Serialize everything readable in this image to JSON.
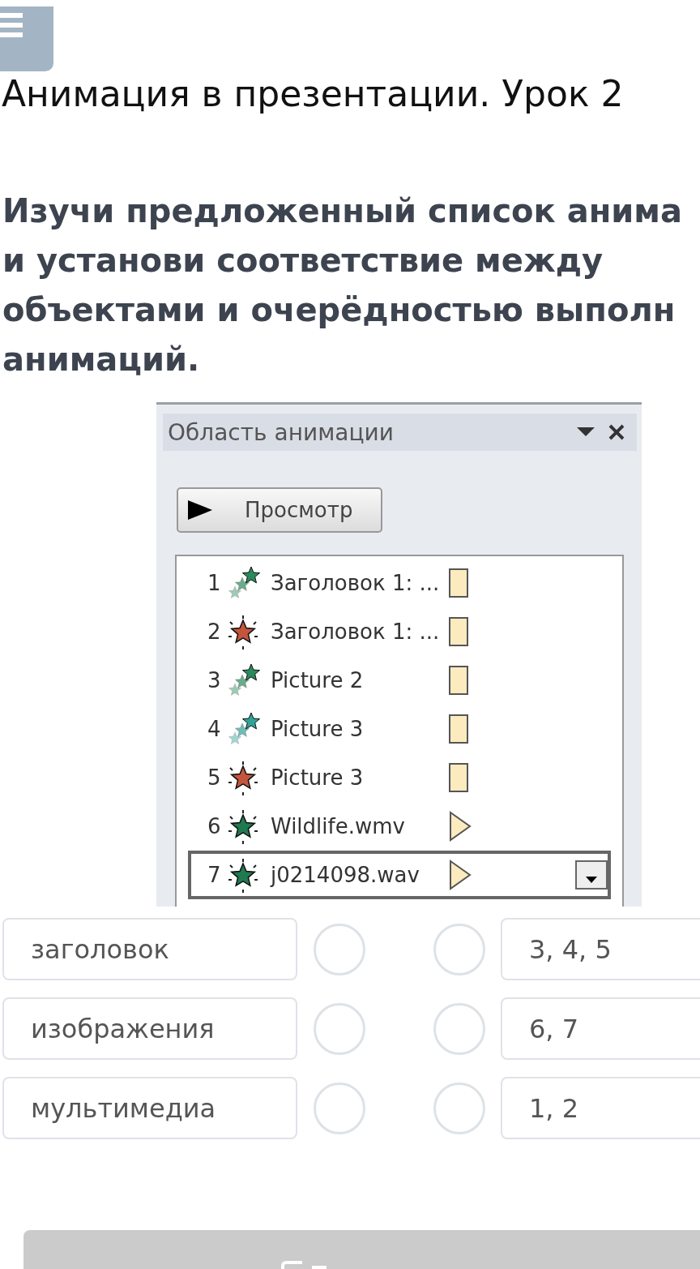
{
  "page_title": "Анимация в презентации. Урок 2",
  "instruction_lines": [
    "Изучи предложенный список анима",
    "и установи соответствие между",
    "объектами и очерёдностью выполн",
    "анимаций."
  ],
  "animation_pane": {
    "title": "Область анимации",
    "preview_button": "Просмотр",
    "items": [
      {
        "number": "1",
        "icon": {
          "kind": "path",
          "color": "#2a8a5c"
        },
        "name": "Заголовок 1: ...",
        "marker": {
          "kind": "bar"
        },
        "selected": false
      },
      {
        "number": "2",
        "icon": {
          "kind": "effect",
          "color": "#c4553d"
        },
        "name": "Заголовок 1: ...",
        "marker": {
          "kind": "bar"
        },
        "selected": false
      },
      {
        "number": "3",
        "icon": {
          "kind": "path",
          "color": "#2a8a5c"
        },
        "name": "Picture 2",
        "marker": {
          "kind": "bar"
        },
        "selected": false
      },
      {
        "number": "4",
        "icon": {
          "kind": "path",
          "color": "#2fa39a"
        },
        "name": "Picture 3",
        "marker": {
          "kind": "bar"
        },
        "selected": false
      },
      {
        "number": "5",
        "icon": {
          "kind": "effect",
          "color": "#c4553d"
        },
        "name": "Picture 3",
        "marker": {
          "kind": "bar"
        },
        "selected": false
      },
      {
        "number": "6",
        "icon": {
          "kind": "effect",
          "color": "#1f7a50"
        },
        "name": "Wildlife.wmv",
        "marker": {
          "kind": "trigger"
        },
        "selected": false
      },
      {
        "number": "7",
        "icon": {
          "kind": "effect",
          "color": "#1f7a50"
        },
        "name": "j0214098.wav",
        "marker": {
          "kind": "trigger"
        },
        "selected": true
      }
    ]
  },
  "matching": {
    "left": [
      {
        "text": "заголовок",
        "selected": false
      },
      {
        "text": "изображения",
        "selected": false
      },
      {
        "text": "мультимедиа",
        "selected": false
      }
    ],
    "right": [
      {
        "text": "3, 4, 5",
        "selected": false
      },
      {
        "text": "6, 7",
        "selected": false
      },
      {
        "text": "1, 2",
        "selected": false
      }
    ]
  }
}
